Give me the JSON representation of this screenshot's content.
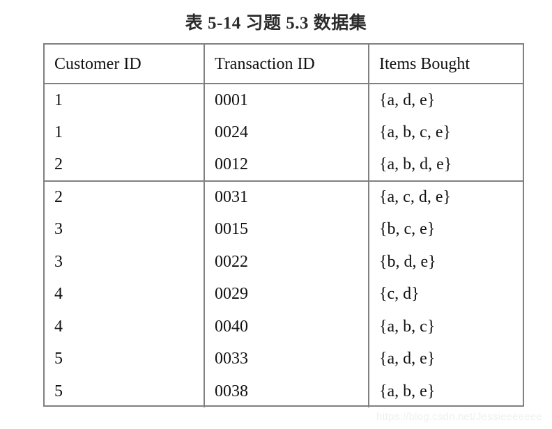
{
  "caption": "表 5-14  习题 5.3 数据集",
  "watermark": "https://blog.csdn.net/Jessieeeeeee",
  "chart_data": {
    "type": "table",
    "title": "表 5-14  习题 5.3 数据集",
    "columns": [
      "Customer ID",
      "Transaction ID",
      "Items Bought"
    ],
    "rows": [
      [
        "1",
        "0001",
        "{a, d, e}"
      ],
      [
        "1",
        "0024",
        "{a, b, c, e}"
      ],
      [
        "2",
        "0012",
        "{a, b, d, e}"
      ],
      [
        "2",
        "0031",
        "{a, c, d, e}"
      ],
      [
        "3",
        "0015",
        "{b, c, e}"
      ],
      [
        "3",
        "0022",
        "{b, d, e}"
      ],
      [
        "4",
        "0029",
        "{c, d}"
      ],
      [
        "4",
        "0040",
        "{a, b, c}"
      ],
      [
        "5",
        "0033",
        "{a, d, e}"
      ],
      [
        "5",
        "0038",
        "{a, b, e}"
      ]
    ],
    "group_separator_after_row": 3,
    "row_count": 10,
    "column_count": 3
  }
}
